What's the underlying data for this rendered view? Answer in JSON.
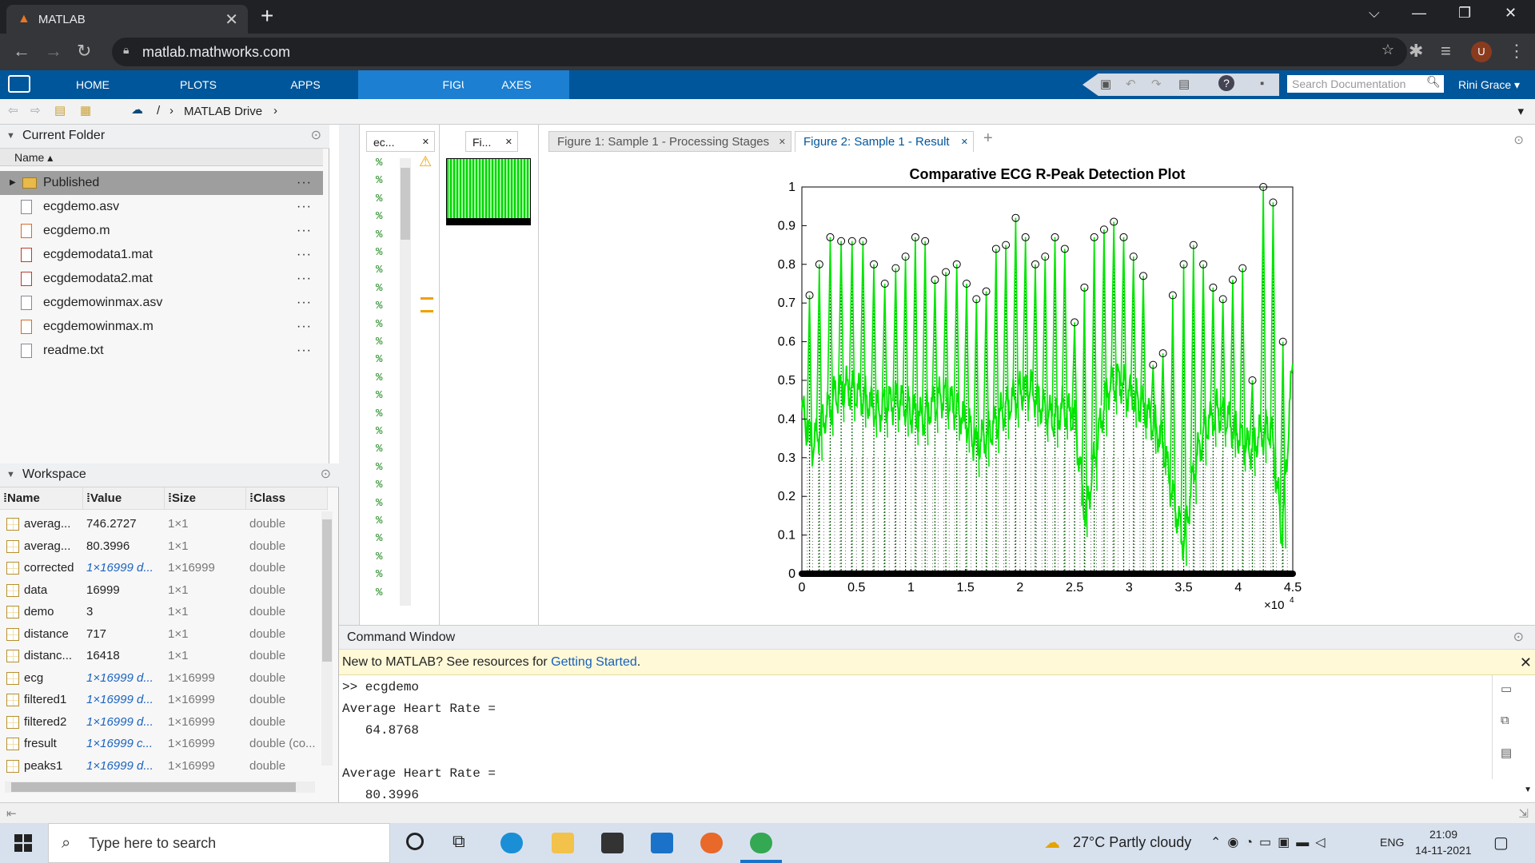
{
  "browser": {
    "tab_title": "MATLAB",
    "tab_close": "✕",
    "new_tab": "+",
    "url": "matlab.mathworks.com",
    "window_controls": [
      "⌵",
      "—",
      "❐",
      "✕"
    ],
    "profile_initial": "U"
  },
  "ribbon": {
    "tabs": [
      "HOME",
      "PLOTS",
      "APPS",
      "FIGURE",
      "AXES"
    ],
    "active_tab": "FIGURE",
    "search_placeholder": "Search Documentation",
    "user": "Rini Grace"
  },
  "address": {
    "sep": "/",
    "path": "MATLAB Drive",
    "arrow": "›"
  },
  "current_folder": {
    "title": "Current Folder",
    "column": "Name",
    "items": [
      {
        "name": "Published",
        "type": "folder"
      },
      {
        "name": "ecgdemo.asv",
        "type": "file"
      },
      {
        "name": "ecgdemo.m",
        "type": "mfile"
      },
      {
        "name": "ecgdemodata1.mat",
        "type": "mat"
      },
      {
        "name": "ecgdemodata2.mat",
        "type": "mat"
      },
      {
        "name": "ecgdemowinmax.asv",
        "type": "file"
      },
      {
        "name": "ecgdemowinmax.m",
        "type": "mfile"
      },
      {
        "name": "readme.txt",
        "type": "file"
      }
    ],
    "more": "···"
  },
  "workspace": {
    "title": "Workspace",
    "columns": [
      "Name",
      "Value",
      "Size",
      "Class"
    ],
    "rows": [
      {
        "name": "averag...",
        "value": "746.2727",
        "size": "1×1",
        "class": "double",
        "italic": false
      },
      {
        "name": "averag...",
        "value": "80.3996",
        "size": "1×1",
        "class": "double",
        "italic": false
      },
      {
        "name": "corrected",
        "value": "1×16999 d...",
        "size": "1×16999",
        "class": "double",
        "italic": true
      },
      {
        "name": "data",
        "value": "16999",
        "size": "1×1",
        "class": "double",
        "italic": false
      },
      {
        "name": "demo",
        "value": "3",
        "size": "1×1",
        "class": "double",
        "italic": false
      },
      {
        "name": "distance",
        "value": "717",
        "size": "1×1",
        "class": "double",
        "italic": false
      },
      {
        "name": "distanc...",
        "value": "16418",
        "size": "1×1",
        "class": "double",
        "italic": false
      },
      {
        "name": "ecg",
        "value": "1×16999 d...",
        "size": "1×16999",
        "class": "double",
        "italic": true
      },
      {
        "name": "filtered1",
        "value": "1×16999 d...",
        "size": "1×16999",
        "class": "double",
        "italic": true
      },
      {
        "name": "filtered2",
        "value": "1×16999 d...",
        "size": "1×16999",
        "class": "double",
        "italic": true
      },
      {
        "name": "fresult",
        "value": "1×16999 c...",
        "size": "1×16999",
        "class": "double (co...",
        "italic": true
      },
      {
        "name": "peaks1",
        "value": "1×16999 d...",
        "size": "1×16999",
        "class": "double",
        "italic": true
      }
    ]
  },
  "editor": {
    "tab_label": "ec...",
    "comment_char": "%"
  },
  "figure_small": {
    "tab_label": "Fi..."
  },
  "figure_tabs": [
    {
      "label": "Figure 1: Sample 1 - Processing Stages",
      "selected": false
    },
    {
      "label": "Figure 2: Sample 1 - Result",
      "selected": true
    }
  ],
  "figure_tab_close": "✕",
  "figure_tab_add": "+",
  "chart_data": {
    "type": "line",
    "title": "Comparative  ECG  R-Peak  Detection  Plot",
    "xlabel": "",
    "ylabel": "",
    "xlim": [
      0,
      45000
    ],
    "ylim": [
      0,
      1
    ],
    "x_exponent_label": "×10",
    "x_exponent_power": "4",
    "xticks": [
      "0",
      "0.5",
      "1",
      "1.5",
      "2",
      "2.5",
      "3",
      "3.5",
      "4",
      "4.5"
    ],
    "yticks": [
      "0",
      "0.1",
      "0.2",
      "0.3",
      "0.4",
      "0.5",
      "0.6",
      "0.7",
      "0.8",
      "0.9",
      "1"
    ],
    "grid": false,
    "series": [
      {
        "color": "#00e600",
        "peaks_x": [
          700,
          1600,
          2600,
          3600,
          4600,
          5600,
          6600,
          7600,
          8600,
          9500,
          10400,
          11300,
          12200,
          13200,
          14200,
          15100,
          16000,
          16900,
          17800,
          18700,
          19600,
          20500,
          21400,
          22300,
          23200,
          24100,
          25000,
          25900,
          26800,
          27700,
          28600,
          29500,
          30400,
          31300,
          32200,
          33100,
          34000,
          35000,
          35900,
          36800,
          37700,
          38600,
          39500,
          40400,
          41300,
          42300,
          43200,
          44100
        ],
        "peaks_y": [
          0.72,
          0.8,
          0.87,
          0.86,
          0.86,
          0.86,
          0.8,
          0.75,
          0.79,
          0.82,
          0.87,
          0.86,
          0.76,
          0.78,
          0.8,
          0.75,
          0.71,
          0.73,
          0.84,
          0.85,
          0.92,
          0.87,
          0.8,
          0.82,
          0.87,
          0.84,
          0.65,
          0.74,
          0.87,
          0.89,
          0.91,
          0.87,
          0.82,
          0.77,
          0.54,
          0.57,
          0.72,
          0.8,
          0.85,
          0.8,
          0.74,
          0.71,
          0.76,
          0.79,
          0.5,
          1.0,
          0.96,
          0.6
        ],
        "baseline_x": [
          0,
          1000,
          2000,
          3000,
          4000,
          5000,
          6000,
          7000,
          8000,
          9000,
          10000,
          11000,
          12000,
          13000,
          14000,
          15000,
          16000,
          17000,
          18000,
          19000,
          20000,
          21000,
          22000,
          23000,
          24000,
          25000,
          26000,
          27000,
          28000,
          29000,
          30000,
          31000,
          32000,
          33000,
          34000,
          35000,
          36000,
          37000,
          38000,
          39000,
          40000,
          41000,
          42000,
          43000,
          44000,
          45000
        ],
        "baseline_y": [
          0.42,
          0.33,
          0.4,
          0.46,
          0.48,
          0.47,
          0.45,
          0.42,
          0.44,
          0.45,
          0.42,
          0.4,
          0.44,
          0.46,
          0.43,
          0.4,
          0.33,
          0.36,
          0.4,
          0.44,
          0.47,
          0.48,
          0.43,
          0.4,
          0.43,
          0.4,
          0.15,
          0.33,
          0.48,
          0.5,
          0.47,
          0.44,
          0.4,
          0.35,
          0.2,
          0.08,
          0.28,
          0.38,
          0.42,
          0.4,
          0.36,
          0.32,
          0.36,
          0.38,
          0.1,
          0.55
        ]
      }
    ]
  },
  "command_window": {
    "title": "Command Window",
    "banner_prefix": "New to MATLAB? See resources for ",
    "banner_link": "Getting Started",
    "banner_suffix": ".",
    "lines": [
      ">> ecgdemo",
      "Average Heart Rate =",
      "   64.8768",
      "",
      "Average Heart Rate =",
      "   80.3996"
    ]
  },
  "taskbar": {
    "search_placeholder": "Type here to search",
    "weather": "27°C  Partly cloudy",
    "lang": "ENG",
    "time": "21:09",
    "date": "14-11-2021"
  }
}
